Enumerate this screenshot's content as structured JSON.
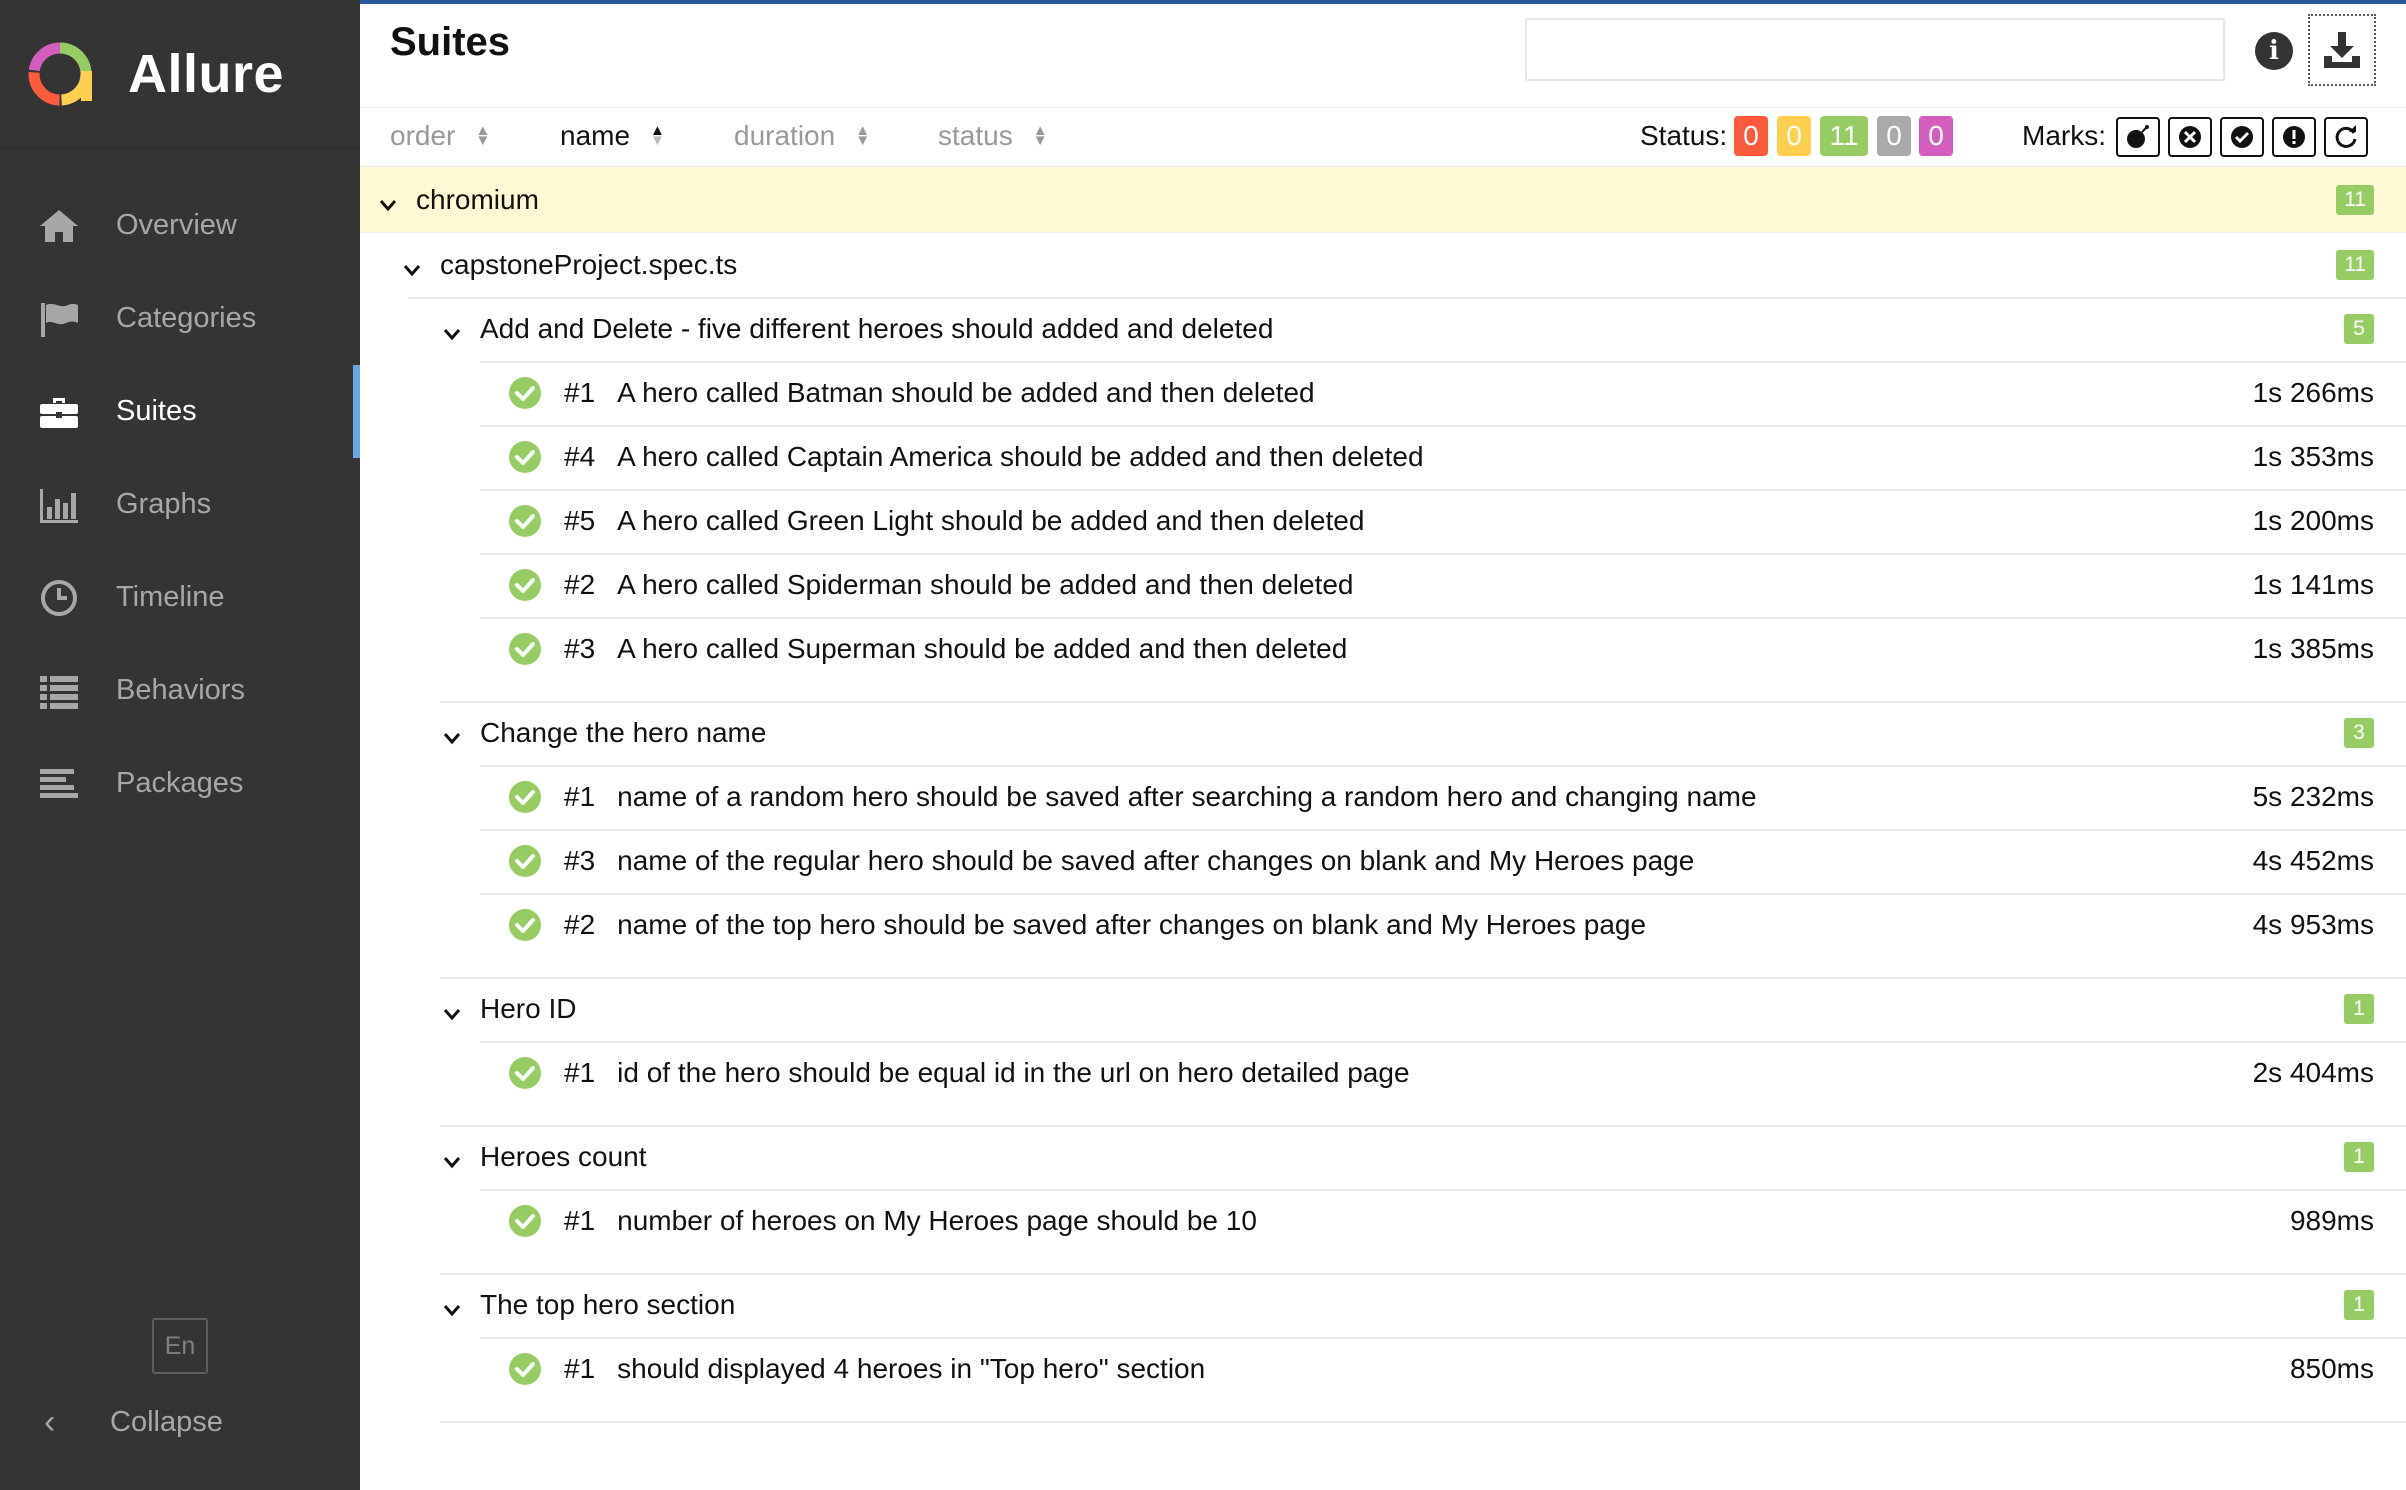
{
  "app": {
    "name": "Allure"
  },
  "sidebar": {
    "items": [
      {
        "label": "Overview",
        "icon": "home-icon"
      },
      {
        "label": "Categories",
        "icon": "flag-icon"
      },
      {
        "label": "Suites",
        "icon": "briefcase-icon",
        "active": true
      },
      {
        "label": "Graphs",
        "icon": "bar-chart-icon"
      },
      {
        "label": "Timeline",
        "icon": "clock-icon"
      },
      {
        "label": "Behaviors",
        "icon": "list-icon"
      },
      {
        "label": "Packages",
        "icon": "align-left-icon"
      }
    ],
    "language": "En",
    "collapse_label": "Collapse"
  },
  "header": {
    "title": "Suites",
    "search_value": ""
  },
  "toolbar": {
    "sort": [
      "order",
      "name",
      "duration",
      "status"
    ],
    "active_sort": "name",
    "status_label": "Status:",
    "status_counts": [
      {
        "name": "failed",
        "value": "0",
        "color": "#fd5a3e"
      },
      {
        "name": "broken",
        "value": "0",
        "color": "#ffd050"
      },
      {
        "name": "passed",
        "value": "11",
        "color": "#97cc64"
      },
      {
        "name": "skipped",
        "value": "0",
        "color": "#aaaaaa"
      },
      {
        "name": "unknown",
        "value": "0",
        "color": "#d35ebe"
      }
    ],
    "marks_label": "Marks:",
    "marks": [
      "flaky-bomb-icon",
      "new-failed-icon",
      "new-passed-icon",
      "new-broken-icon",
      "retries-icon"
    ]
  },
  "tree": {
    "root": {
      "name": "chromium",
      "count": "11"
    },
    "file": {
      "name": "capstoneProject.spec.ts",
      "count": "11"
    },
    "suites": [
      {
        "name": "Add and Delete - five different heroes should added and deleted",
        "count": "5",
        "tests": [
          {
            "num": "#1",
            "name": "A hero called Batman should be added and then deleted",
            "duration": "1s 266ms"
          },
          {
            "num": "#4",
            "name": "A hero called Captain America should be added and then deleted",
            "duration": "1s 353ms"
          },
          {
            "num": "#5",
            "name": "A hero called Green Light should be added and then deleted",
            "duration": "1s 200ms"
          },
          {
            "num": "#2",
            "name": "A hero called Spiderman should be added and then deleted",
            "duration": "1s 141ms"
          },
          {
            "num": "#3",
            "name": "A hero called Superman should be added and then deleted",
            "duration": "1s 385ms"
          }
        ]
      },
      {
        "name": "Change the hero name",
        "count": "3",
        "tests": [
          {
            "num": "#1",
            "name": "name of a random hero should be saved after searching a random hero and changing name",
            "duration": "5s 232ms"
          },
          {
            "num": "#3",
            "name": "name of the regular hero should be saved after changes on blank and My Heroes page",
            "duration": "4s 452ms"
          },
          {
            "num": "#2",
            "name": "name of the top hero should be saved after changes on blank and My Heroes page",
            "duration": "4s 953ms"
          }
        ]
      },
      {
        "name": "Hero ID",
        "count": "1",
        "tests": [
          {
            "num": "#1",
            "name": "id of the hero should be equal id in the url on hero detailed page",
            "duration": "2s 404ms"
          }
        ]
      },
      {
        "name": "Heroes count",
        "count": "1",
        "tests": [
          {
            "num": "#1",
            "name": "number of heroes on My Heroes page should be 10",
            "duration": "989ms"
          }
        ]
      },
      {
        "name": "The top hero section",
        "count": "1",
        "tests": [
          {
            "num": "#1",
            "name": "should displayed 4 heroes in \"Top hero\" section",
            "duration": "850ms"
          }
        ]
      }
    ]
  }
}
